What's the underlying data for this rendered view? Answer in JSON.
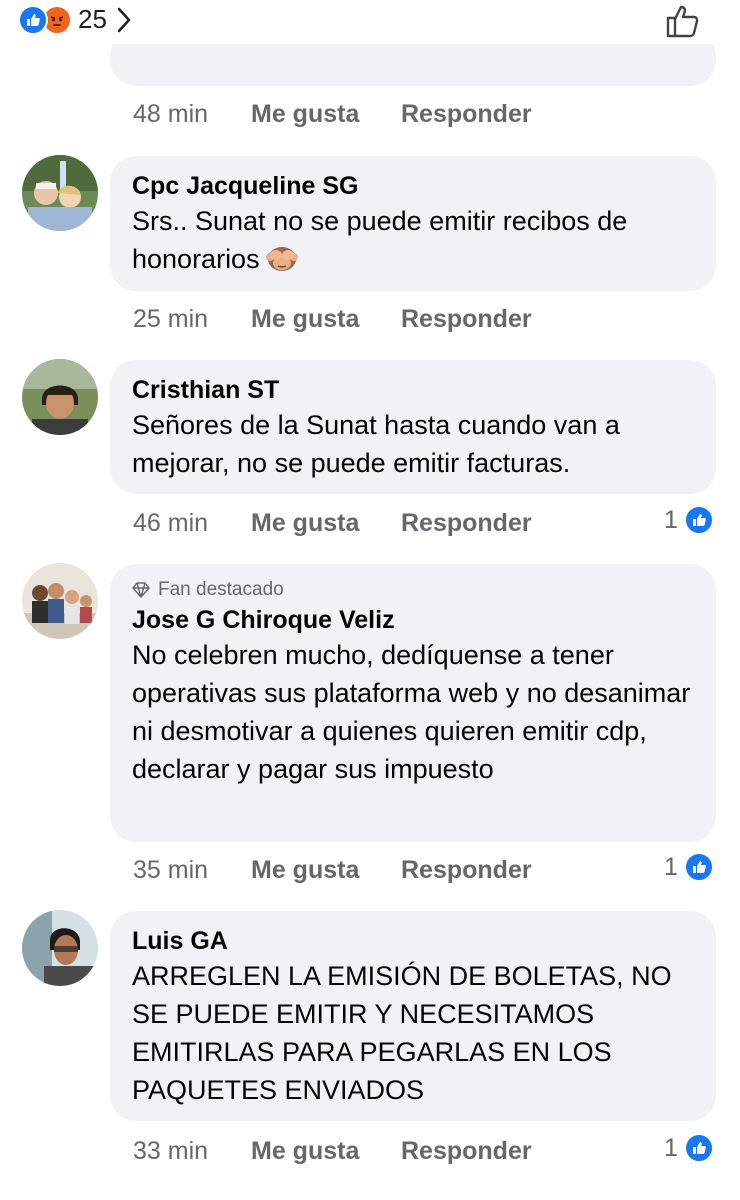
{
  "top": {
    "reaction_count": "25",
    "reaction_icons": [
      "like-icon",
      "angry-icon"
    ]
  },
  "previous_comment": {
    "time": "48 min",
    "like_label": "Me gusta",
    "reply_label": "Responder"
  },
  "comments": [
    {
      "author": "Cpc Jacqueline SG",
      "text": "Srs.. Sunat no se puede emitir recibos de honorarios",
      "emoji": "see-no-evil-monkey",
      "time": "25 min",
      "like_label": "Me gusta",
      "reply_label": "Responder"
    },
    {
      "author": "Cristhian ST",
      "text": "Señores de la Sunat hasta cuando van a mejorar, no se puede emitir facturas.",
      "time": "46 min",
      "like_label": "Me gusta",
      "reply_label": "Responder",
      "likes": "1"
    },
    {
      "badge": "Fan destacado",
      "author": "Jose G Chiroque Veliz",
      "text": "No celebren mucho, dedíquense a tener operativas sus plataforma web y no desanimar ni desmotivar a quienes quieren emitir cdp, declarar y pagar sus impuesto",
      "time": "35 min",
      "like_label": "Me gusta",
      "reply_label": "Responder",
      "likes": "1"
    },
    {
      "author": "Luis GA",
      "text": "ARREGLEN LA EMISIÓN DE BOLETAS, NO SE PUEDE EMITIR Y NECESITAMOS EMITIRLAS PARA PEGARLAS EN LOS PAQUETES ENVIADOS",
      "time": "33 min",
      "like_label": "Me gusta",
      "reply_label": "Responder",
      "likes": "1"
    }
  ],
  "colors": {
    "bubble": "#f0f2f5",
    "meta_text": "#65676b",
    "like_blue": "#1877f2",
    "angry_orange": "#f0641e"
  }
}
